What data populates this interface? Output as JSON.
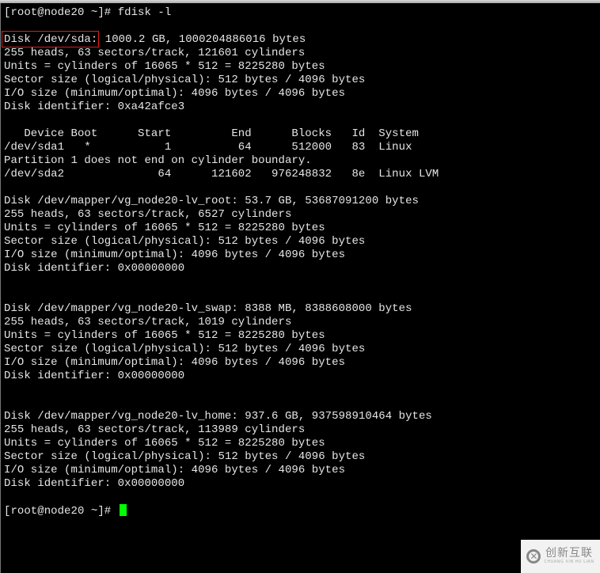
{
  "terminal": {
    "command_prompt": "[root@node20 ~]# ",
    "command": "fdisk -l",
    "highlight_label": "Disk /dev/sda:",
    "sda_rest": " 1000.2 GB, 1000204886016 bytes",
    "lines": [
      "255 heads, 63 sectors/track, 121601 cylinders",
      "Units = cylinders of 16065 * 512 = 8225280 bytes",
      "Sector size (logical/physical): 512 bytes / 4096 bytes",
      "I/O size (minimum/optimal): 4096 bytes / 4096 bytes",
      "Disk identifier: 0xa42afce3",
      "",
      "   Device Boot      Start         End      Blocks   Id  System",
      "/dev/sda1   *           1          64      512000   83  Linux",
      "Partition 1 does not end on cylinder boundary.",
      "/dev/sda2              64      121602   976248832   8e  Linux LVM",
      "",
      "Disk /dev/mapper/vg_node20-lv_root: 53.7 GB, 53687091200 bytes",
      "255 heads, 63 sectors/track, 6527 cylinders",
      "Units = cylinders of 16065 * 512 = 8225280 bytes",
      "Sector size (logical/physical): 512 bytes / 4096 bytes",
      "I/O size (minimum/optimal): 4096 bytes / 4096 bytes",
      "Disk identifier: 0x00000000",
      "",
      "",
      "Disk /dev/mapper/vg_node20-lv_swap: 8388 MB, 8388608000 bytes",
      "255 heads, 63 sectors/track, 1019 cylinders",
      "Units = cylinders of 16065 * 512 = 8225280 bytes",
      "Sector size (logical/physical): 512 bytes / 4096 bytes",
      "I/O size (minimum/optimal): 4096 bytes / 4096 bytes",
      "Disk identifier: 0x00000000",
      "",
      "",
      "Disk /dev/mapper/vg_node20-lv_home: 937.6 GB, 937598910464 bytes",
      "255 heads, 63 sectors/track, 113989 cylinders",
      "Units = cylinders of 16065 * 512 = 8225280 bytes",
      "Sector size (logical/physical): 512 bytes / 4096 bytes",
      "I/O size (minimum/optimal): 4096 bytes / 4096 bytes",
      "Disk identifier: 0x00000000",
      ""
    ],
    "final_prompt": "[root@node20 ~]# "
  },
  "colors": {
    "background": "#000000",
    "text": "#e6e6e6",
    "cursor": "#00ff00",
    "highlight_box": "#e01c1c"
  },
  "watermark": {
    "icon": "chuangxin-logo-icon",
    "logo_glyph": "✕",
    "text_cn": "创新互联",
    "text_en": "CHUANG XIN HU LIAN"
  }
}
